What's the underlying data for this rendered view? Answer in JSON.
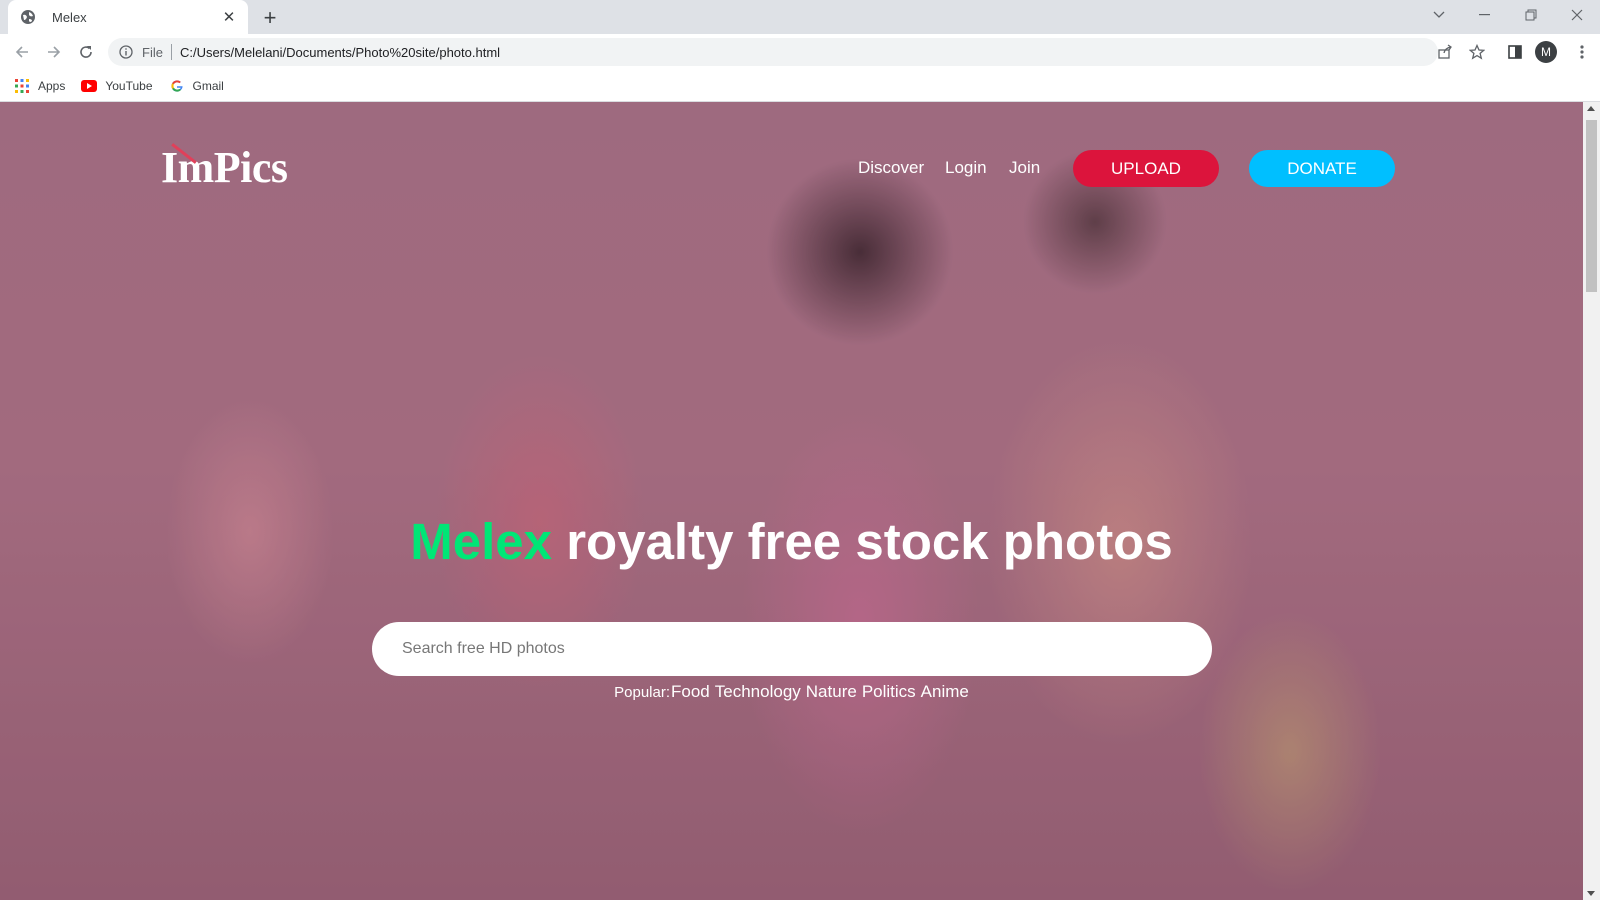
{
  "browser": {
    "tab_title": "Melex",
    "tab_close": "✕",
    "new_tab": "+",
    "scheme_label": "File",
    "url": "C:/Users/Melelani/Documents/Photo%20site/photo.html",
    "profile_initial": "M",
    "bookmarks": [
      {
        "label": "Apps",
        "icon": "apps-grid-icon"
      },
      {
        "label": "YouTube",
        "icon": "youtube-icon"
      },
      {
        "label": "Gmail",
        "icon": "google-icon"
      }
    ]
  },
  "site": {
    "logo": "ImPics",
    "nav": {
      "discover": "Discover",
      "login": "Login",
      "join": "Join",
      "upload": "UPLOAD",
      "donate": "DONATE"
    },
    "headline_brand": "Melex",
    "headline_rest": " royalty free stock photos",
    "search_placeholder": "Search free HD photos",
    "popular_label": "Popular:",
    "popular_tags": [
      "Food",
      "Technology",
      "Nature",
      "Politics",
      "Anime"
    ]
  },
  "colors": {
    "upload": "#dc143c",
    "donate": "#00bfff",
    "brand_accent": "#00e676"
  }
}
